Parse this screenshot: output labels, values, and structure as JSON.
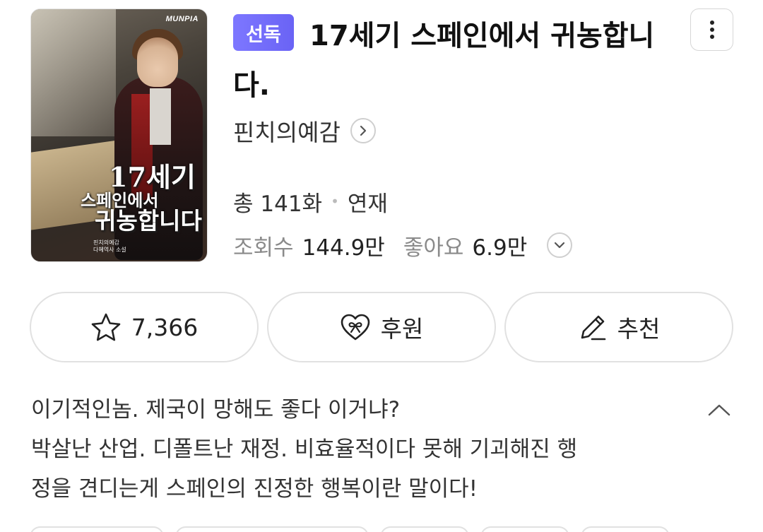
{
  "cover": {
    "publisher": "MUNPIA",
    "title_lines": [
      "17세기",
      "스페인에서",
      "귀농합니다"
    ],
    "author_lines": [
      "핀치의예감",
      "다혜역사 소설"
    ]
  },
  "badge": "선독",
  "title": "17세기 스페인에서 귀농합니다.",
  "author": "핀치의예감",
  "meta": {
    "episodes": "총 141화",
    "status": "연재",
    "views_label": "조회수",
    "views_value": "144.9만",
    "likes_label": "좋아요",
    "likes_value": "6.9만"
  },
  "actions": {
    "favorite_count": "7,366",
    "support_label": "후원",
    "recommend_label": "추천"
  },
  "synopsis": [
    "이기적인놈. 제국이 망해도 좋다 이거냐?",
    "박살난 산업. 디폴트난 재정. 비효율적이다 못해 기괴해진 행",
    "정을 견디는게 스페인의 진정한 행복이란 말이다!"
  ],
  "icons": {
    "more": "more-vertical-icon",
    "author_chevron": "chevron-right-icon",
    "stats_chevron": "chevron-down-icon",
    "favorite": "star-icon",
    "support": "heart-gift-icon",
    "recommend": "pencil-icon",
    "collapse": "chevron-up-icon"
  },
  "colors": {
    "badge": "#6f69f8",
    "border": "#e1e1e1"
  }
}
